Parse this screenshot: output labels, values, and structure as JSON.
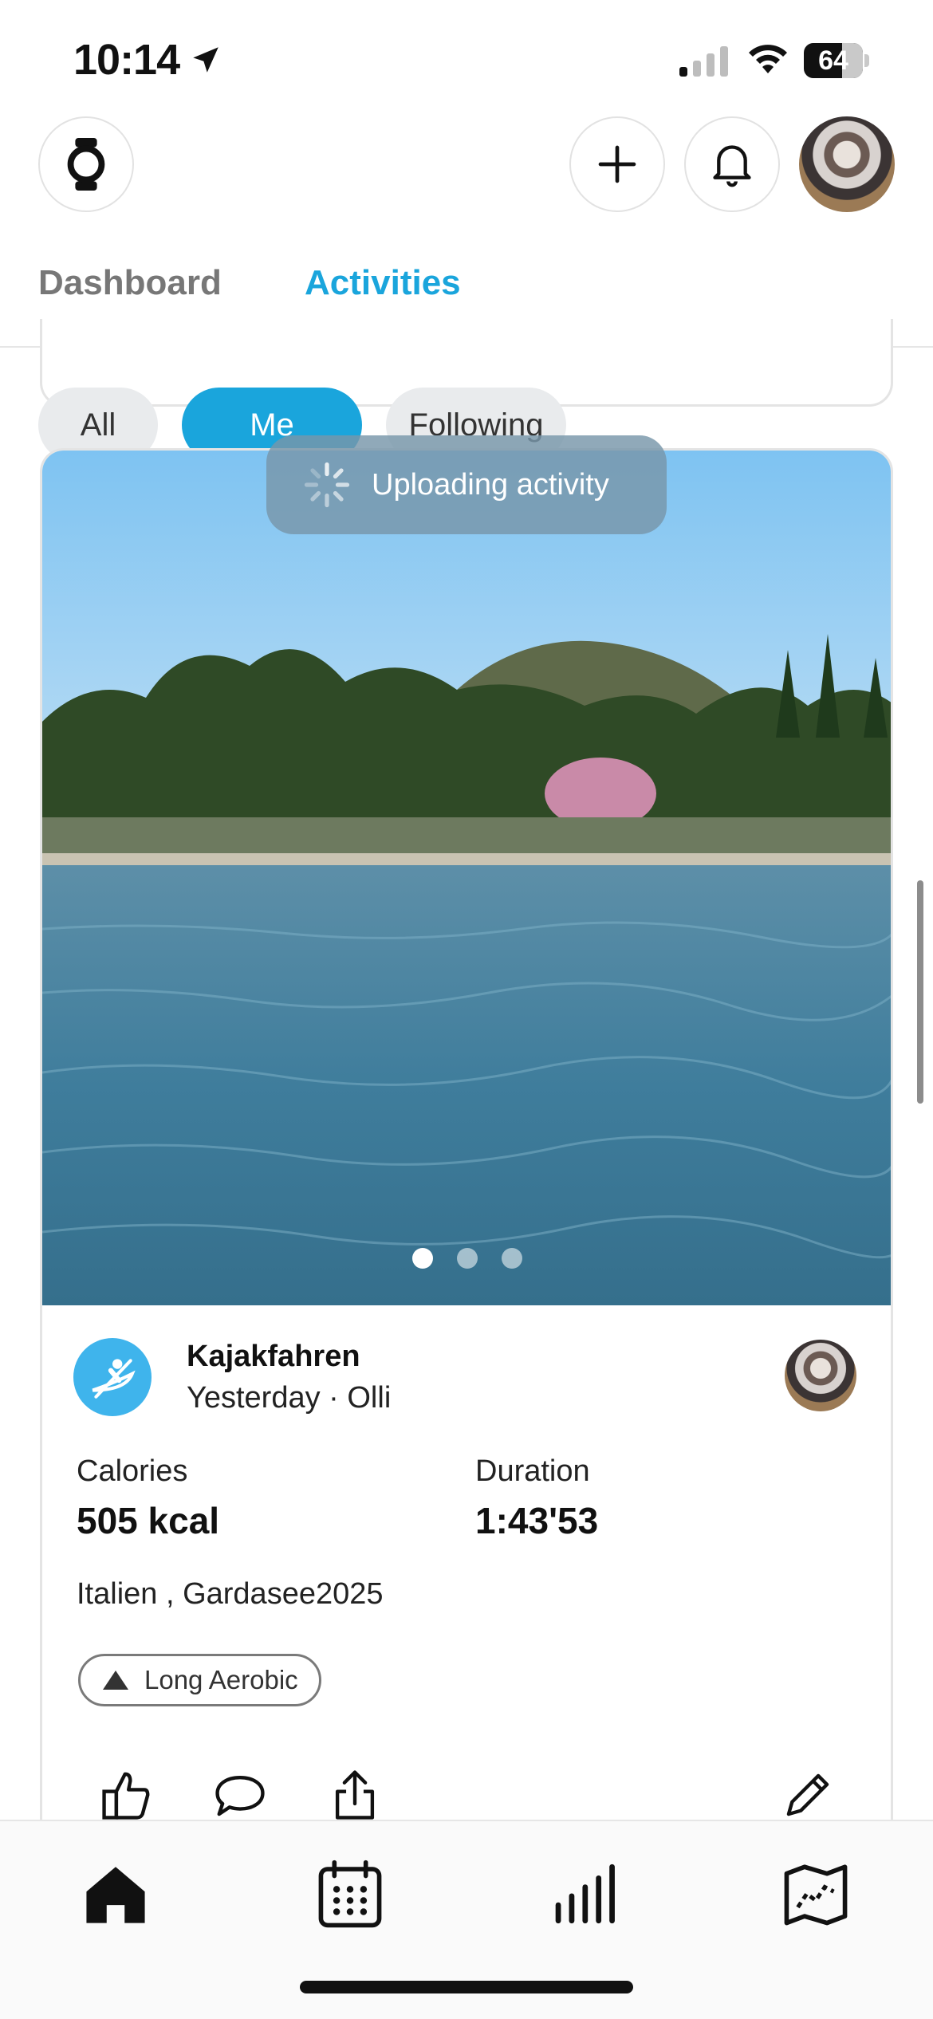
{
  "status_bar": {
    "time": "10:14",
    "battery": "64"
  },
  "header": {
    "icons": [
      "watch-icon",
      "plus-icon",
      "bell-icon",
      "profile-avatar"
    ]
  },
  "tabs": [
    {
      "label": "Dashboard",
      "active": false
    },
    {
      "label": "Activities",
      "active": true
    }
  ],
  "filters": [
    {
      "label": "All",
      "active": false
    },
    {
      "label": "Me",
      "active": true
    },
    {
      "label": "Following",
      "active": false
    }
  ],
  "toast": {
    "text": "Uploading activity"
  },
  "activity": {
    "sport_icon": "kayak-icon",
    "title": "Kajakfahren",
    "subtitle": "Yesterday · Olli",
    "stats": [
      {
        "label": "Calories",
        "value": "505 kcal"
      },
      {
        "label": "Duration",
        "value": "1:43'53"
      }
    ],
    "location": "Italien , Gardasee2025",
    "badge": "Long Aerobic",
    "photo_count": 3,
    "photo_active_index": 0
  },
  "bottom_nav": [
    "home-icon",
    "calendar-icon",
    "stats-icon",
    "map-icon"
  ],
  "colors": {
    "accent": "#1aa5dc",
    "sport": "#3fb4ec"
  }
}
